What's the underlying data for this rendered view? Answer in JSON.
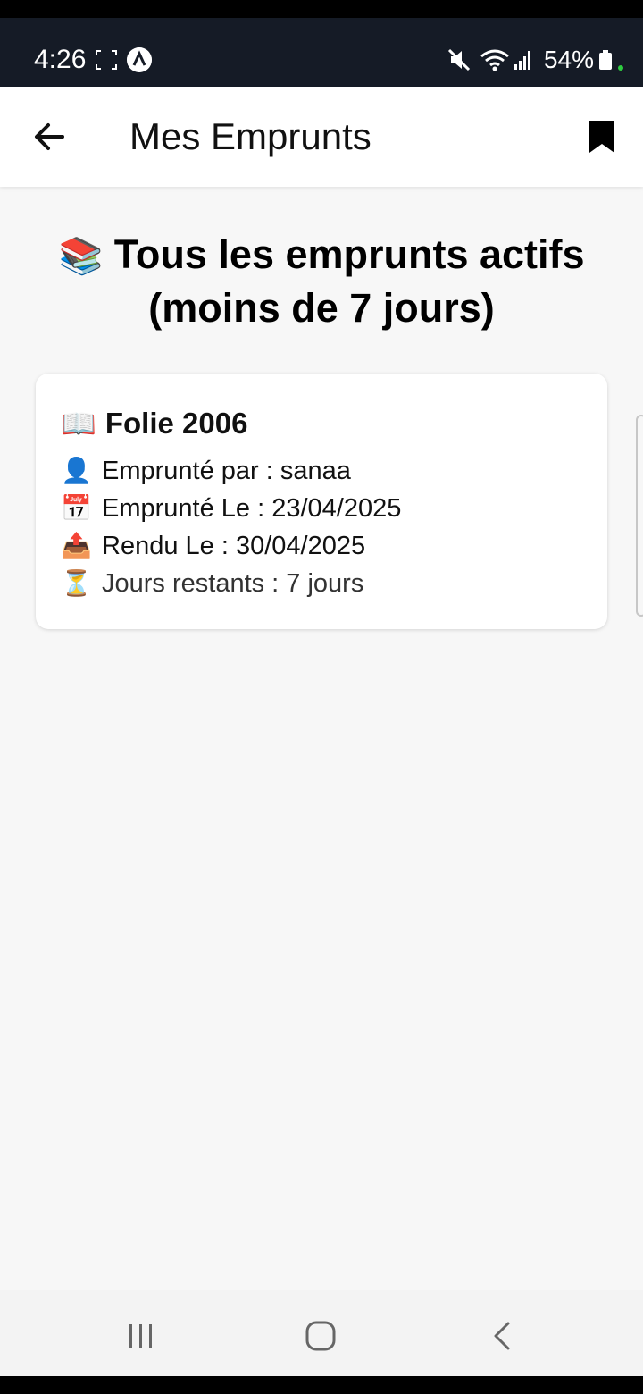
{
  "status_bar": {
    "time": "4:26",
    "battery_percent": "54%",
    "icons": [
      "focus-frame-icon",
      "a-circle-icon",
      "mute-icon",
      "wifi-icon",
      "signal-icon",
      "battery-icon",
      "notification-dot-icon"
    ]
  },
  "app_bar": {
    "title": "Mes Emprunts",
    "back_icon": "arrow-left-icon",
    "action_icon": "bookmark-icon"
  },
  "main": {
    "heading_emoji": "📚",
    "heading_line1": "Tous les emprunts actifs",
    "heading_line2": "(moins de 7 jours)"
  },
  "loans": [
    {
      "title_emoji": "📖",
      "title": "Folie 2006",
      "borrower_emoji": "👤",
      "borrower": "Emprunté par : sanaa",
      "date_emoji": "📅",
      "borrowed_on": "Emprunté Le : 23/04/2025",
      "return_emoji": "📤",
      "returned_on": "Rendu Le : 30/04/2025",
      "remaining_emoji": "⏳",
      "remaining": "Jours restants : 7 jours"
    }
  ],
  "colors": {
    "status_bar": "#151b26",
    "app_bar": "#ffffff",
    "background": "#f7f7f7",
    "card": "#ffffff",
    "nav_bar": "#f3f3f3"
  }
}
